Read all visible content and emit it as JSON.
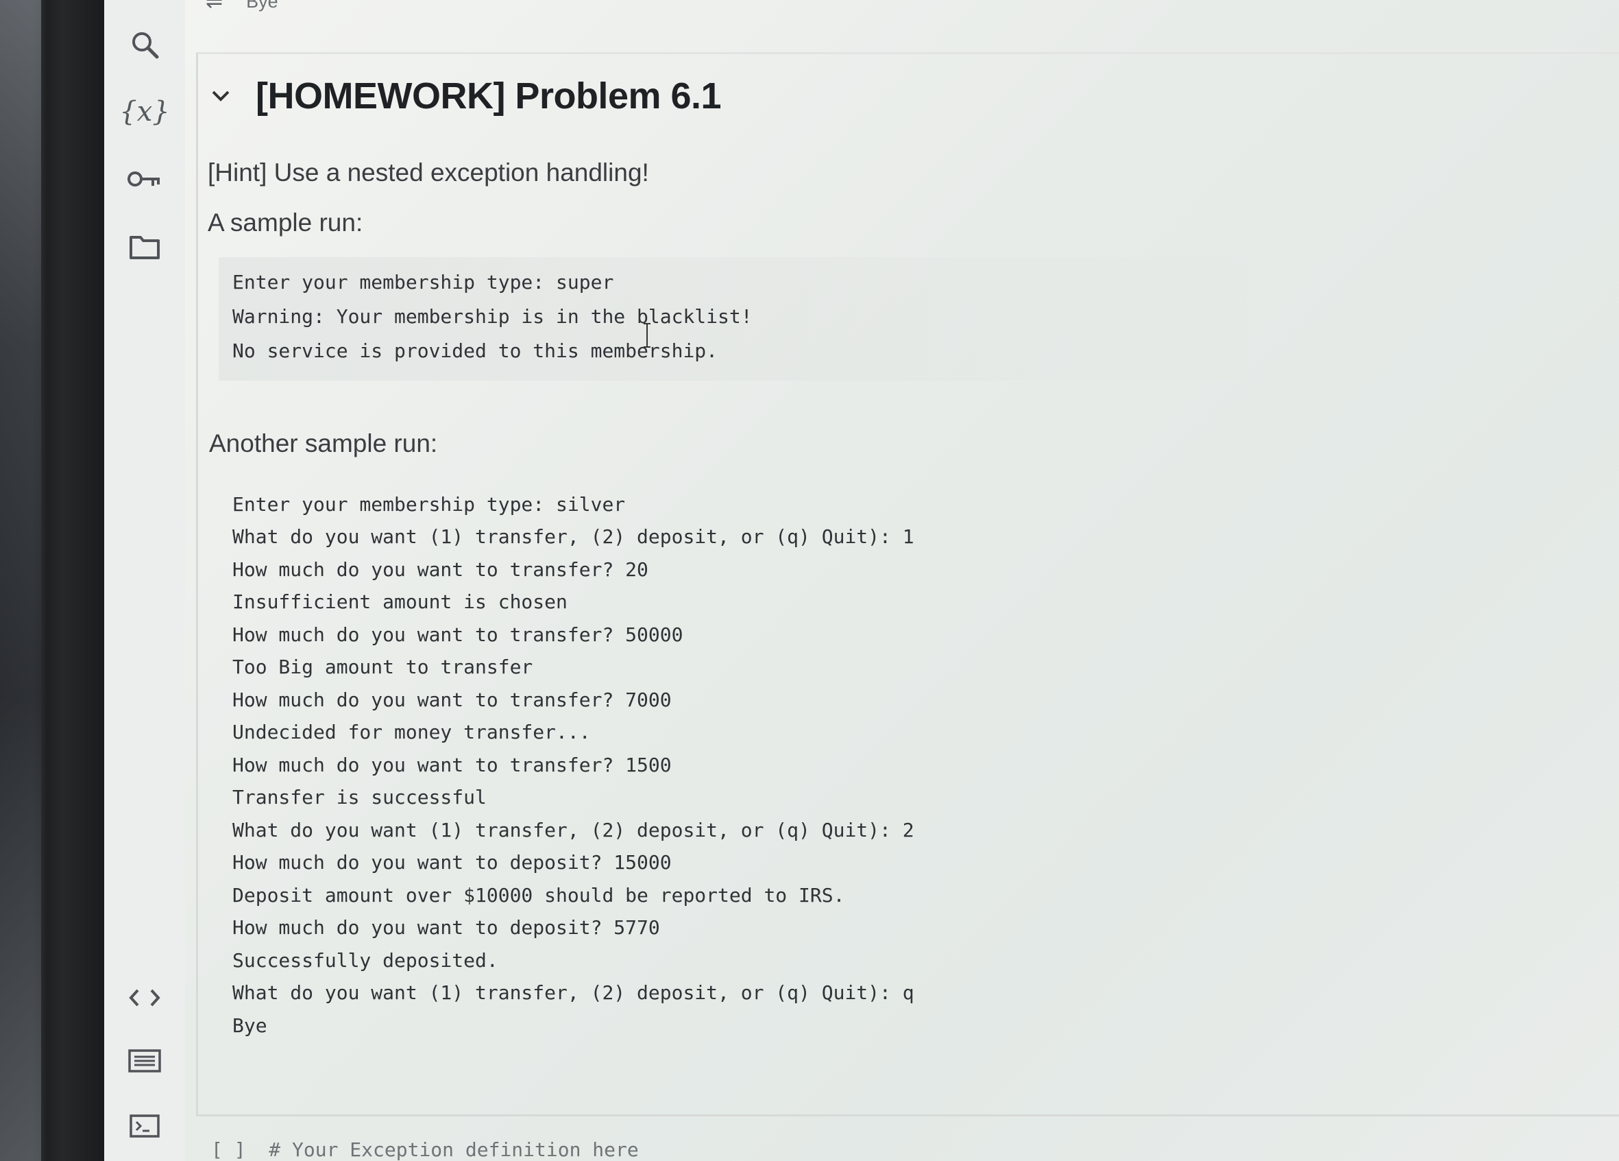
{
  "top_output": {
    "text": "Bye"
  },
  "sidebar": {
    "icons": [
      "search-icon",
      "variables-icon",
      "key-icon",
      "folder-icon",
      "code-icon",
      "command-palette-icon",
      "terminal-icon"
    ],
    "variables_glyph": "{x}"
  },
  "cell": {
    "title": "[HOMEWORK] Problem 6.1",
    "hint": "[Hint] Use a nested exception handling!",
    "sample_label": "A sample run:",
    "sample_run": [
      "Enter your membership type: super",
      "Warning: Your membership is in the blacklist!",
      "No service is provided to this membership."
    ],
    "another_label": "Another sample run:",
    "another_run": [
      "Enter your membership type: silver",
      "What do you want (1) transfer, (2) deposit, or (q) Quit): 1",
      "How much do you want to transfer? 20",
      "Insufficient amount is chosen",
      "How much do you want to transfer? 50000",
      "Too Big amount to transfer",
      "How much do you want to transfer? 7000",
      "Undecided for money transfer...",
      "How much do you want to transfer? 1500",
      "Transfer is successful",
      "What do you want (1) transfer, (2) deposit, or (q) Quit): 2",
      "How much do you want to deposit? 15000",
      "Deposit amount over $10000 should be reported to IRS.",
      "How much do you want to deposit? 5770",
      "Successfully deposited.",
      "What do you want (1) transfer, (2) deposit, or (q) Quit): q",
      "Bye"
    ]
  },
  "next_cell": {
    "run_marker": "[ ]",
    "code": "# Your Exception definition here"
  },
  "colors": {
    "title": "#1f2225",
    "text": "#3a3e41",
    "code": "#2f3336",
    "rail": "#ebeeec",
    "bezel": "#26282a"
  }
}
